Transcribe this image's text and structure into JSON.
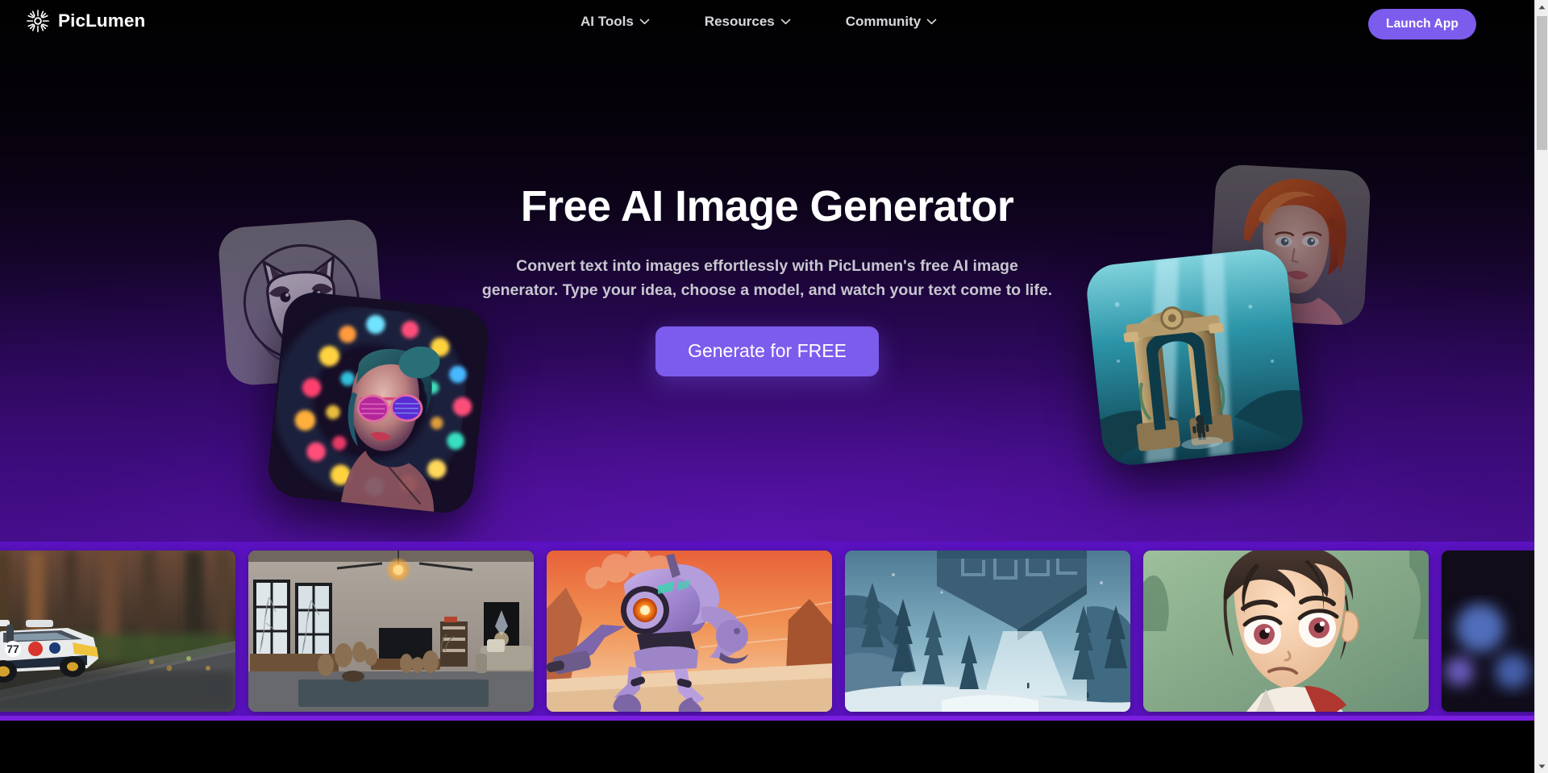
{
  "brand": {
    "name": "PicLumen",
    "logo_icon": "sunburst-icon"
  },
  "nav": {
    "items": [
      {
        "label": "AI Tools",
        "icon": "chevron-down-icon"
      },
      {
        "label": "Resources",
        "icon": "chevron-down-icon"
      },
      {
        "label": "Community",
        "icon": "chevron-down-icon"
      }
    ],
    "launch_label": "Launch App"
  },
  "hero": {
    "title": "Free AI Image Generator",
    "subtitle": "Convert text into images effortlessly with PicLumen's free AI image generator. Type your idea, choose a model, and watch your text come to life.",
    "cta_label": "Generate for FREE"
  },
  "preview_cards": [
    {
      "name": "dog-sketch-card",
      "alt": "Line-art sketch of a smiling husky dog in a circle"
    },
    {
      "name": "neon-portrait-card",
      "alt": "Woman with sunglasses surrounded by colorful bokeh lights"
    },
    {
      "name": "red-hair-portrait-card",
      "alt": "Illustrated portrait of a red-haired woman"
    },
    {
      "name": "underwater-ruins-card",
      "alt": "Diver before sunken stone archway underwater"
    }
  ],
  "gallery": {
    "tiles": [
      {
        "name": "rally-car-tile",
        "alt": "White and blue rally car racing on a forest road"
      },
      {
        "name": "living-room-tile",
        "alt": "Concrete loft living room with large windows and pottery"
      },
      {
        "name": "mech-robot-tile",
        "alt": "Purple mech robot walking across an orange desert"
      },
      {
        "name": "snow-monolith-tile",
        "alt": "Giant carved monolith above a snowy pine valley"
      },
      {
        "name": "anime-boy-tile",
        "alt": "Close-up anime boy with brown hair and red eyes"
      },
      {
        "name": "white-fox-tile",
        "alt": "Close-up of a white fox ear with bokeh lights"
      }
    ]
  },
  "scrollbar": {
    "up_icon": "triangle-up-icon",
    "down_icon": "triangle-down-icon",
    "thumb": "scroll-thumb"
  },
  "colors": {
    "accent_purple": "#7c5cec",
    "strip_purple": "#5b12c2",
    "strip_edge": "#7b1ee0",
    "page_black": "#000000",
    "title_white": "#ffffff",
    "subtitle_grey": "#c8c6d0"
  }
}
